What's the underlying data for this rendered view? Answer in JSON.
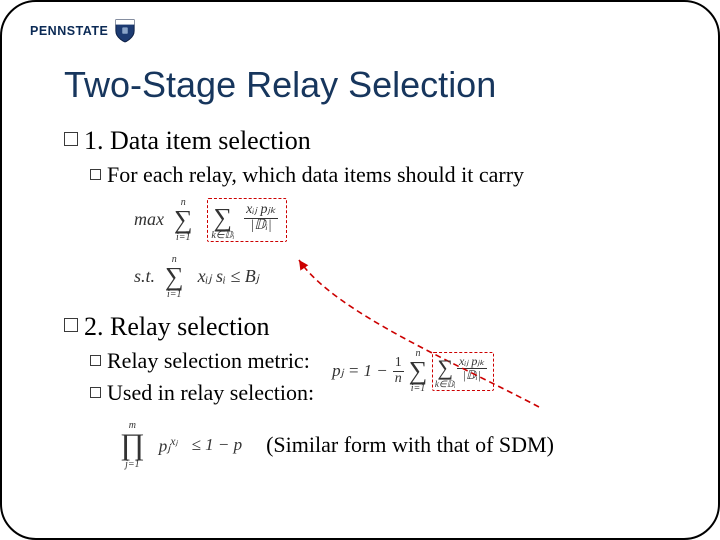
{
  "logo": {
    "text": "PENNSTATE"
  },
  "slide": {
    "title": "Two-Stage Relay Selection",
    "section1": {
      "heading": "1. Data item selection",
      "sub1": "For each relay, which data items should it carry",
      "eq_obj_prefix": "max",
      "eq_st_prefix": "s.t.",
      "eq_obj_sum1_top": "n",
      "eq_obj_sum1_bot": "i=1",
      "eq_obj_sum2_bot": "k∈𝔻ᵢ",
      "eq_obj_frac_num": "xᵢⱼ pⱼₖ",
      "eq_obj_frac_den": "|𝔻ᵢ|",
      "eq_st_sum_top": "n",
      "eq_st_sum_bot": "i=1",
      "eq_st_body": "xᵢⱼ sᵢ ≤ Bⱼ"
    },
    "section2": {
      "heading": "2. Relay selection",
      "sub1": "Relay selection metric:",
      "sub2": "Used in relay selection:",
      "metric_lhs": "pⱼ = 1 −",
      "metric_one_over_n_num": "1",
      "metric_one_over_n_den": "n",
      "metric_sum_top": "n",
      "metric_sum_bot": "i=1",
      "metric_innersum_bot": "k∈𝔻ᵢ",
      "metric_frac_num": "xᵢⱼ pⱼₖ",
      "metric_frac_den": "|𝔻ᵢ|",
      "prod_top": "m",
      "prod_bot": "j=1",
      "prod_body_base": "pⱼ",
      "prod_body_exp": "xⱼ",
      "prod_rhs": "≤ 1 − p",
      "similar": "(Similar form with that of SDM)"
    }
  }
}
